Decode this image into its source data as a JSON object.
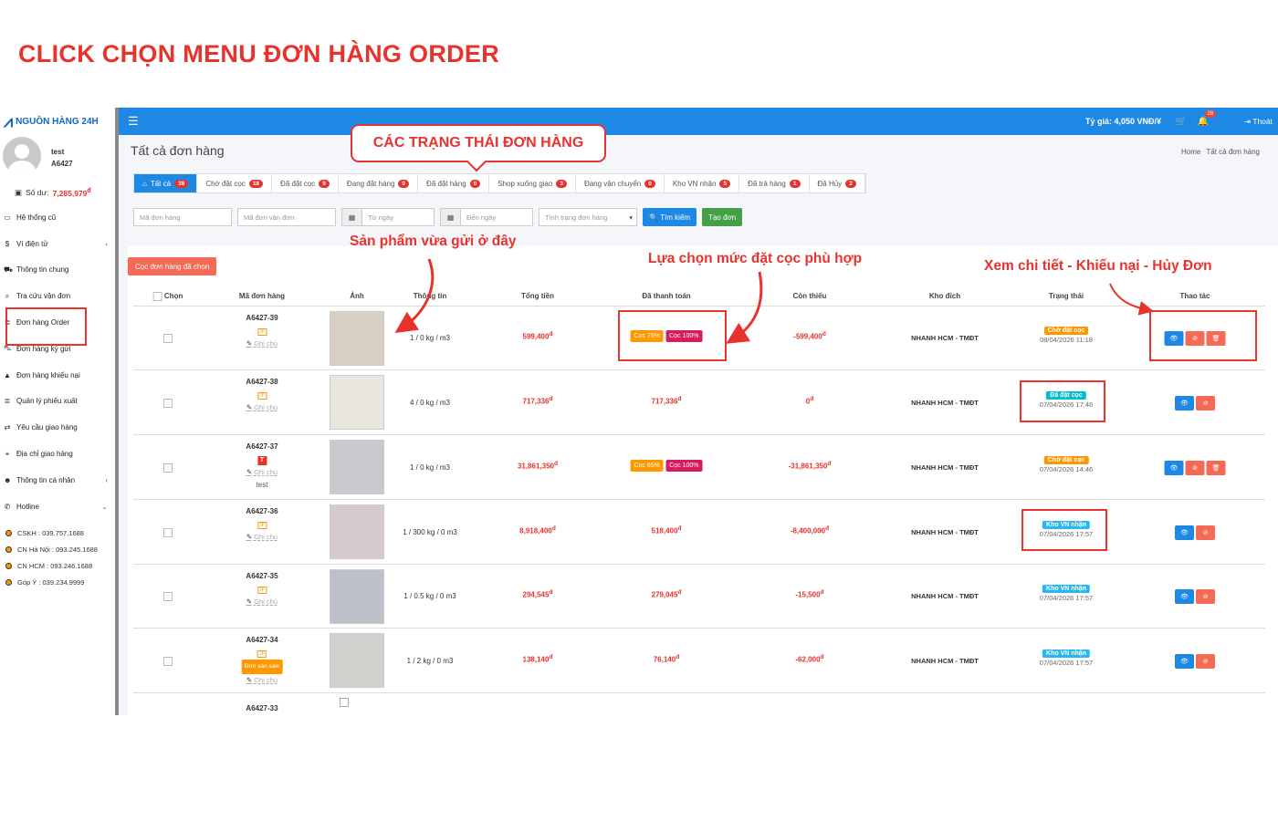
{
  "banner": "CLICK CHỌN MENU ĐƠN HÀNG ORDER",
  "callout": "CÁC TRẠNG THÁI ĐƠN HÀNG",
  "annotations": {
    "product": "Sản phẩm vừa gửi ở đây",
    "deposit": "Lựa chọn mức đặt cọc phù hợp",
    "actions": "Xem chi tiết - Khiếu nại - Hủy Đơn"
  },
  "logo": "NGUỒN HÀNG 24H",
  "user": {
    "name": "test",
    "code": "A6427"
  },
  "balance": {
    "label": "Số dư:",
    "amount": "7,285,979",
    "currency": "đ"
  },
  "sidebar": {
    "items": [
      {
        "label": "Hệ thống cũ",
        "icon": "desktop-icon"
      },
      {
        "label": "Ví điện tử",
        "icon": "dollar-icon",
        "chevron": "‹"
      },
      {
        "label": "Thông tin chung",
        "icon": "truck-icon"
      },
      {
        "label": "Tra cứu vận đơn",
        "icon": "search-icon"
      },
      {
        "label": "Đơn hàng Order",
        "icon": "list-icon"
      },
      {
        "label": "Đơn hàng ký gửi",
        "icon": "car-icon"
      },
      {
        "label": "Đơn hàng khiếu nại",
        "icon": "warning-icon"
      },
      {
        "label": "Quản lý phiếu xuất",
        "icon": "list-icon"
      },
      {
        "label": "Yêu cầu giao hàng",
        "icon": "exchange-icon"
      },
      {
        "label": "Địa chỉ giao hàng",
        "icon": "map-icon"
      },
      {
        "label": "Thông tin cá nhân",
        "icon": "users-icon",
        "chevron": "‹"
      },
      {
        "label": "Hotline",
        "icon": "phone-icon",
        "chevron": "⌄"
      }
    ],
    "contacts": [
      "CSKH : 039.757.1688",
      "CN Hà Nội : 093.245.1688",
      "CN HCM : 093.246.1688",
      "Góp Ý : 039.234.9999"
    ]
  },
  "topbar": {
    "rate": "Tỷ giá: 4,050 VNĐ/¥",
    "notifications": "28",
    "logout": "Thoát"
  },
  "page": {
    "title": "Tất cả đơn hàng",
    "crumb_home": "Home",
    "crumb_current": "Tất cả đơn hàng"
  },
  "tabs": [
    {
      "label": "Tất cả",
      "count": "38"
    },
    {
      "label": "Chờ đặt cọc",
      "count": "18"
    },
    {
      "label": "Đã đặt cọc",
      "count": "9"
    },
    {
      "label": "Đang đặt hàng",
      "count": "0"
    },
    {
      "label": "Đã đặt hàng",
      "count": "0"
    },
    {
      "label": "Shop xuống giao",
      "count": "3"
    },
    {
      "label": "Đang vận chuyển",
      "count": "0"
    },
    {
      "label": "Kho VN nhận",
      "count": "5"
    },
    {
      "label": "Đã trả hàng",
      "count": "1"
    },
    {
      "label": "Đã Hủy",
      "count": "2"
    }
  ],
  "filters": {
    "order_code": "Mã đơn hàng",
    "shipping_code": "Mã đơn vận đơn",
    "from_date": "Từ ngày",
    "to_date": "Đến ngày",
    "status": "Tình trạng đơn hàng",
    "search": "Tìm kiếm",
    "create": "Tạo đơn"
  },
  "deposit_selected": "Cọc đơn hàng đã chọn",
  "table": {
    "headers": [
      "Chọn",
      "Mã đơn hàng",
      "Ảnh",
      "Thông tin",
      "Tổng tiền",
      "Đã thanh toán",
      "Còn thiếu",
      "Kho đích",
      "Trạng thái",
      "Thao tác"
    ],
    "note_label": "Ghi chú",
    "rows": [
      {
        "code": "A6427-39",
        "badge": "jp",
        "info": "1 / 0 kg / m3",
        "total": "599,400",
        "paid": "",
        "deposit_low": "Cọc 75%",
        "deposit_full": "Cọc 100%",
        "missing": "-599,400",
        "warehouse": "NHANH HCM - TMĐT",
        "status": "Chờ đặt cọc",
        "status_type": "wait",
        "date": "08/04/2026 11:18",
        "cancel": true,
        "extra": ""
      },
      {
        "code": "A6427-38",
        "badge": "jp",
        "info": "4 / 0 kg / m3",
        "total": "717,336",
        "paid": "717,336",
        "deposit_low": "",
        "deposit_full": "",
        "missing": "0",
        "warehouse": "NHANH HCM - TMĐT",
        "status": "Đã đặt cọc",
        "status_type": "dep",
        "date": "07/04/2026 17:46",
        "cancel": false,
        "extra": ""
      },
      {
        "code": "A6427-37",
        "badge": "tb",
        "info": "1 / 0 kg / m3",
        "total": "31,861,350",
        "paid": "",
        "deposit_low": "Cọc 65%",
        "deposit_full": "Cọc 100%",
        "missing": "-31,861,350",
        "warehouse": "NHANH HCM - TMĐT",
        "status": "Chờ đặt cọc",
        "status_type": "wait",
        "date": "07/04/2026 14:46",
        "cancel": true,
        "extra": "test"
      },
      {
        "code": "A6427-36",
        "badge": "jp",
        "info": "1 / 300 kg / 0 m3",
        "total": "8,918,400",
        "paid": "518,400",
        "deposit_low": "",
        "deposit_full": "",
        "missing": "-8,400,000",
        "warehouse": "NHANH HCM - TMĐT",
        "status": "Kho VN nhận",
        "status_type": "kho",
        "date": "07/04/2026 17:57",
        "cancel": false,
        "extra": ""
      },
      {
        "code": "A6427-35",
        "badge": "jp",
        "info": "1 / 0.5 kg / 0 m3",
        "total": "294,545",
        "paid": "279,045",
        "deposit_low": "",
        "deposit_full": "",
        "missing": "-15,500",
        "warehouse": "NHANH HCM - TMĐT",
        "status": "Kho VN nhận",
        "status_type": "kho",
        "date": "07/04/2026 17:57",
        "cancel": false,
        "extra": ""
      },
      {
        "code": "A6427-34",
        "badge": "jp",
        "info": "1 / 2 kg / 0 m3",
        "total": "138,140",
        "paid": "76,140",
        "deposit_low": "",
        "deposit_full": "",
        "missing": "-62,000",
        "warehouse": "NHANH HCM - TMĐT",
        "status": "Kho VN nhận",
        "status_type": "kho",
        "date": "07/04/2026 17:57",
        "cancel": false,
        "extra": "Đơn sàn sale"
      }
    ],
    "last_code": "A6427-33"
  },
  "currency": "đ"
}
